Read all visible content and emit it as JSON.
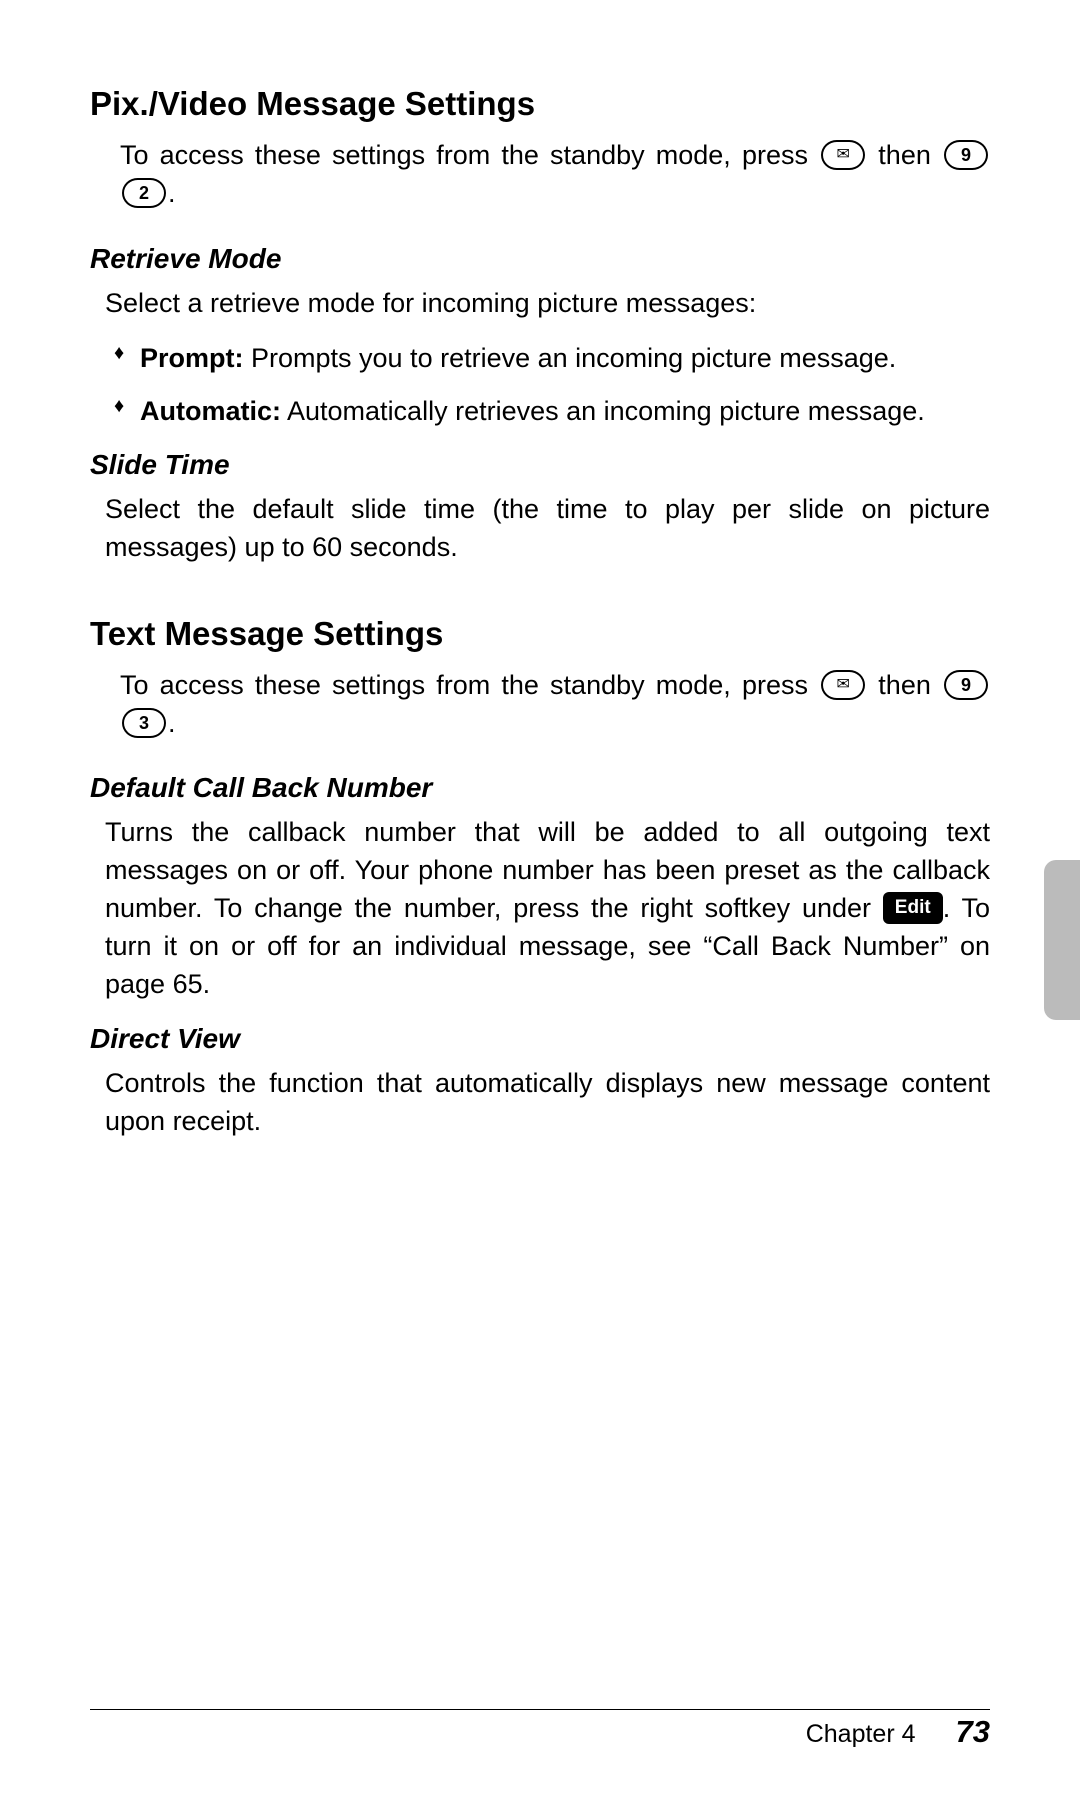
{
  "sections": {
    "pix": {
      "heading": "Pix./Video Message Settings",
      "intro_before": "To access these settings from the standby mode, press ",
      "intro_after": " then ",
      "intro_end": ".",
      "keys": {
        "mail": "✉",
        "nine": "9",
        "two": "2"
      },
      "retrieve": {
        "heading": "Retrieve Mode",
        "body": "Select a retrieve mode for incoming picture messages:",
        "bullets": {
          "prompt_label": "Prompt:",
          "prompt_text": " Prompts you to retrieve an incoming picture message.",
          "auto_label": "Automatic:",
          "auto_text": " Automatically retrieves an incoming picture message."
        }
      },
      "slide": {
        "heading": "Slide Time",
        "body": "Select the default slide time (the time to play per slide on picture messages) up to 60 seconds."
      }
    },
    "text": {
      "heading": "Text Message Settings",
      "intro_before": "To access these settings from the standby mode, press ",
      "intro_after": " then ",
      "intro_end": ".",
      "keys": {
        "mail": "✉",
        "nine": "9",
        "three": "3"
      },
      "callback": {
        "heading": "Default Call Back Number",
        "body_before": "Turns the callback number that will be added to all outgoing text messages on or off. Your phone number has been preset as the callback number. To change the number, press the right softkey under ",
        "edit_label": "Edit",
        "body_after": ". To turn it on or off for an individual message, see “Call Back Number” on page 65."
      },
      "directview": {
        "heading": "Direct View",
        "body": "Controls the function that automatically displays new message content upon receipt."
      }
    }
  },
  "footer": {
    "chapter": "Chapter 4",
    "page": "73"
  }
}
